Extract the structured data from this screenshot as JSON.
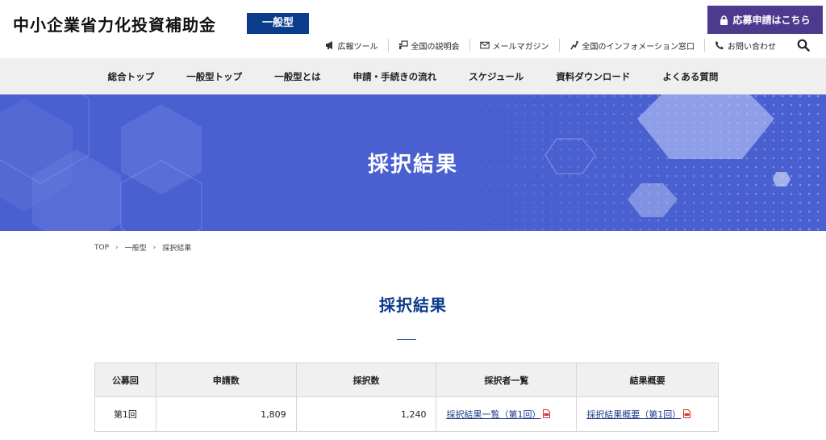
{
  "header": {
    "site_title": "中小企業省力化投資補助金",
    "type_badge": "一般型",
    "apply_button": "応募申請はこちら",
    "util_links": [
      {
        "label": "広報ツール",
        "icon": "megaphone-icon"
      },
      {
        "label": "全国の説明会",
        "icon": "presentation-icon"
      },
      {
        "label": "メールマガジン",
        "icon": "mail-icon"
      },
      {
        "label": "全国のインフォメーション窓口",
        "icon": "info-desk-icon"
      },
      {
        "label": "お問い合わせ",
        "icon": "phone-icon"
      }
    ]
  },
  "nav": {
    "items": [
      "総合トップ",
      "一般型トップ",
      "一般型とは",
      "申請・手続きの流れ",
      "スケジュール",
      "資料ダウンロード",
      "よくある質問"
    ]
  },
  "hero": {
    "title": "採択結果"
  },
  "breadcrumb": {
    "items": [
      "TOP",
      "一般型",
      "採択結果"
    ],
    "separator": "›"
  },
  "main": {
    "title": "採択結果",
    "table": {
      "headers": [
        "公募回",
        "申請数",
        "採択数",
        "採択者一覧",
        "結果概要"
      ],
      "rows": [
        {
          "round": "第1回",
          "applications": "1,809",
          "adopted": "1,240",
          "list_link": "採択結果一覧（第1回）",
          "summary_link": "採択結果概要（第1回）"
        }
      ]
    }
  },
  "colors": {
    "brand_navy": "#0b3c8c",
    "apply_purple": "#4d3a8e",
    "hero_blue": "#4a5fd0",
    "link": "#1f3a8a",
    "pdf_red": "#d9342b"
  }
}
